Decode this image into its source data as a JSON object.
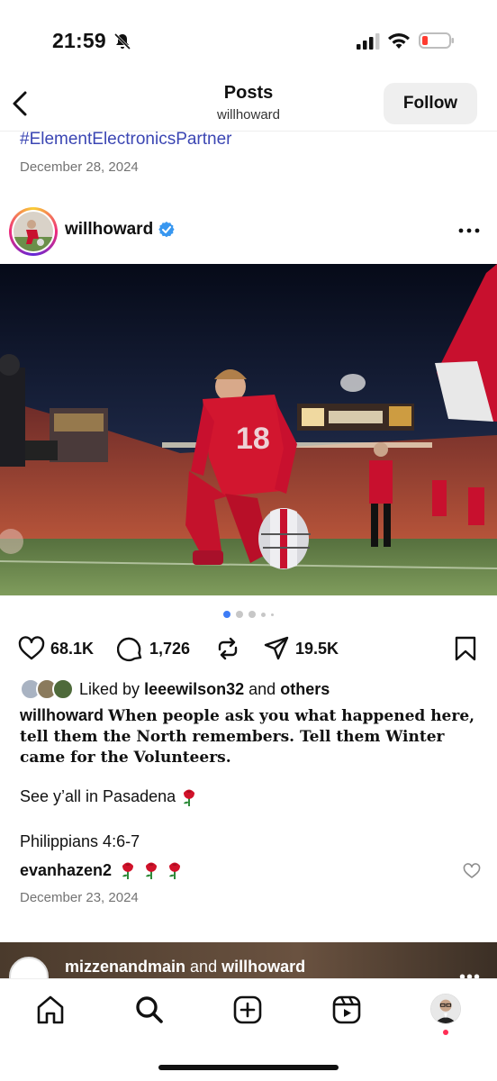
{
  "status_bar": {
    "time": "21:59"
  },
  "header": {
    "title": "Posts",
    "subtitle": "willhoward",
    "follow_label": "Follow"
  },
  "previous_post": {
    "hashtag": "#ElementElectronicsPartner",
    "date": "December 28, 2024"
  },
  "post": {
    "username": "willhoward",
    "verified": true,
    "carousel": {
      "count": 5,
      "active_index": 0
    },
    "likes": "68.1K",
    "comments": "1,726",
    "shares": "19.5K",
    "liked_by": {
      "prefix": "Liked by",
      "user": "leeewilson32",
      "joiner": "and",
      "suffix": "others"
    },
    "caption": {
      "user": "willhoward",
      "text": "When people ask you what happened here, tell them the North remembers. Tell them Winter came for the Volunteers.",
      "line2": "See y’all in Pasadena",
      "line3": "Philippians 4:6-7"
    },
    "top_comment": {
      "user": "evanhazen2"
    },
    "date": "December 23, 2024"
  },
  "next_post": {
    "user1": "mizzenandmain",
    "joiner": "and",
    "user2": "willhoward"
  },
  "colors": {
    "link_blue": "#3b46b3",
    "verified_blue": "#3897f0",
    "active_dot": "#3d7cf6",
    "notification": "#ff2d55"
  }
}
